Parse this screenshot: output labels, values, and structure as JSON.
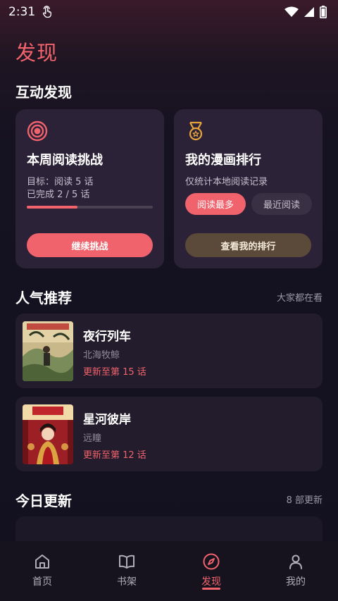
{
  "status_bar": {
    "time": "2:31"
  },
  "page": {
    "title": "发现"
  },
  "interactive": {
    "section_title": "互动发现",
    "challenge": {
      "title": "本周阅读挑战",
      "goal": "目标：阅读 5 话",
      "done": "已完成 2 / 5 话",
      "progress": 0.4,
      "button": "继续挑战"
    },
    "ranking": {
      "title": "我的漫画排行",
      "desc": "仅统计本地阅读记录",
      "tab_most": "阅读最多",
      "tab_recent": "最近阅读",
      "button": "查看我的排行"
    }
  },
  "popular": {
    "section_title": "人气推荐",
    "aside": "大家都在看",
    "items": [
      {
        "title": "夜行列车",
        "author": "北海牧鲸",
        "update": "更新至第 15 话"
      },
      {
        "title": "星河彼岸",
        "author": "远瞳",
        "update": "更新至第 12 话"
      }
    ]
  },
  "today": {
    "section_title": "今日更新",
    "aside": "8 部更新"
  },
  "nav": {
    "items": [
      {
        "label": "首页",
        "icon": "home-icon"
      },
      {
        "label": "书架",
        "icon": "book-icon"
      },
      {
        "label": "发现",
        "icon": "compass-icon"
      },
      {
        "label": "我的",
        "icon": "user-icon"
      }
    ],
    "active_index": 2
  },
  "colors": {
    "accent": "#f0636c",
    "card": "#2c2238",
    "gold": "#e8a43a",
    "brown_button": "#5b4a3a"
  }
}
